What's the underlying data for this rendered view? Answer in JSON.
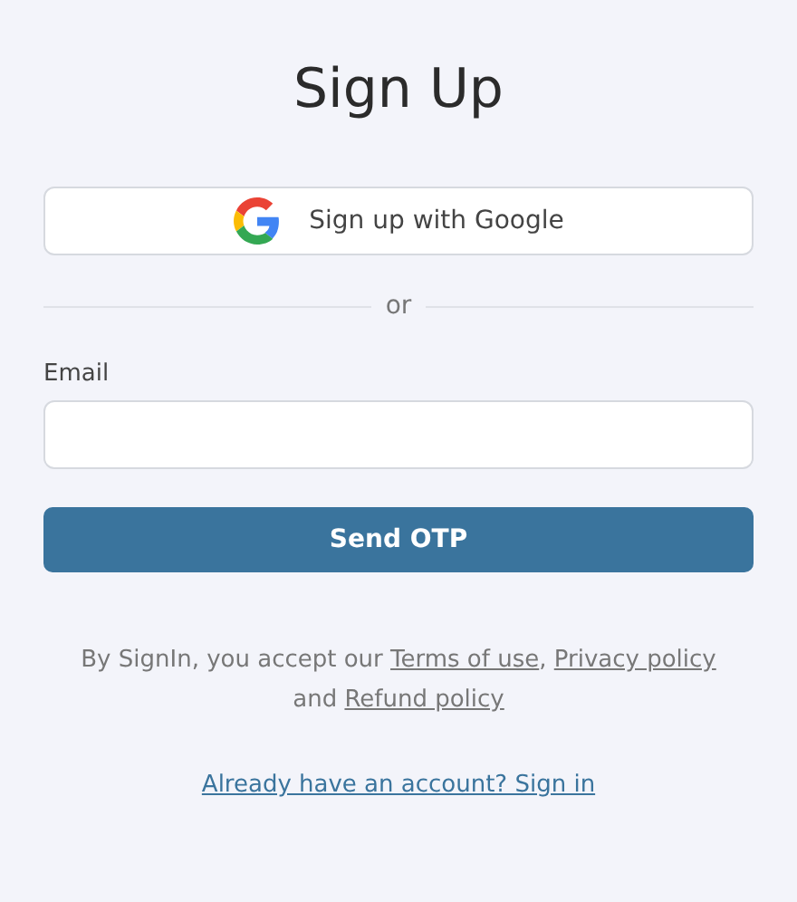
{
  "title": "Sign Up",
  "google_button": {
    "label": "Sign up with Google"
  },
  "divider": {
    "label": "or"
  },
  "email": {
    "label": "Email"
  },
  "submit_button": {
    "label": "Send OTP"
  },
  "terms": [
    {
      "kind": "text",
      "text": "By SignIn, you accept our "
    },
    {
      "kind": "link",
      "text": "Terms of use"
    },
    {
      "kind": "text",
      "text": ", "
    },
    {
      "kind": "link",
      "text": "Privacy policy"
    },
    {
      "kind": "text",
      "text": " and "
    },
    {
      "kind": "link",
      "text": "Refund policy"
    }
  ],
  "signin_link": {
    "label": "Already have an account? Sign in"
  }
}
